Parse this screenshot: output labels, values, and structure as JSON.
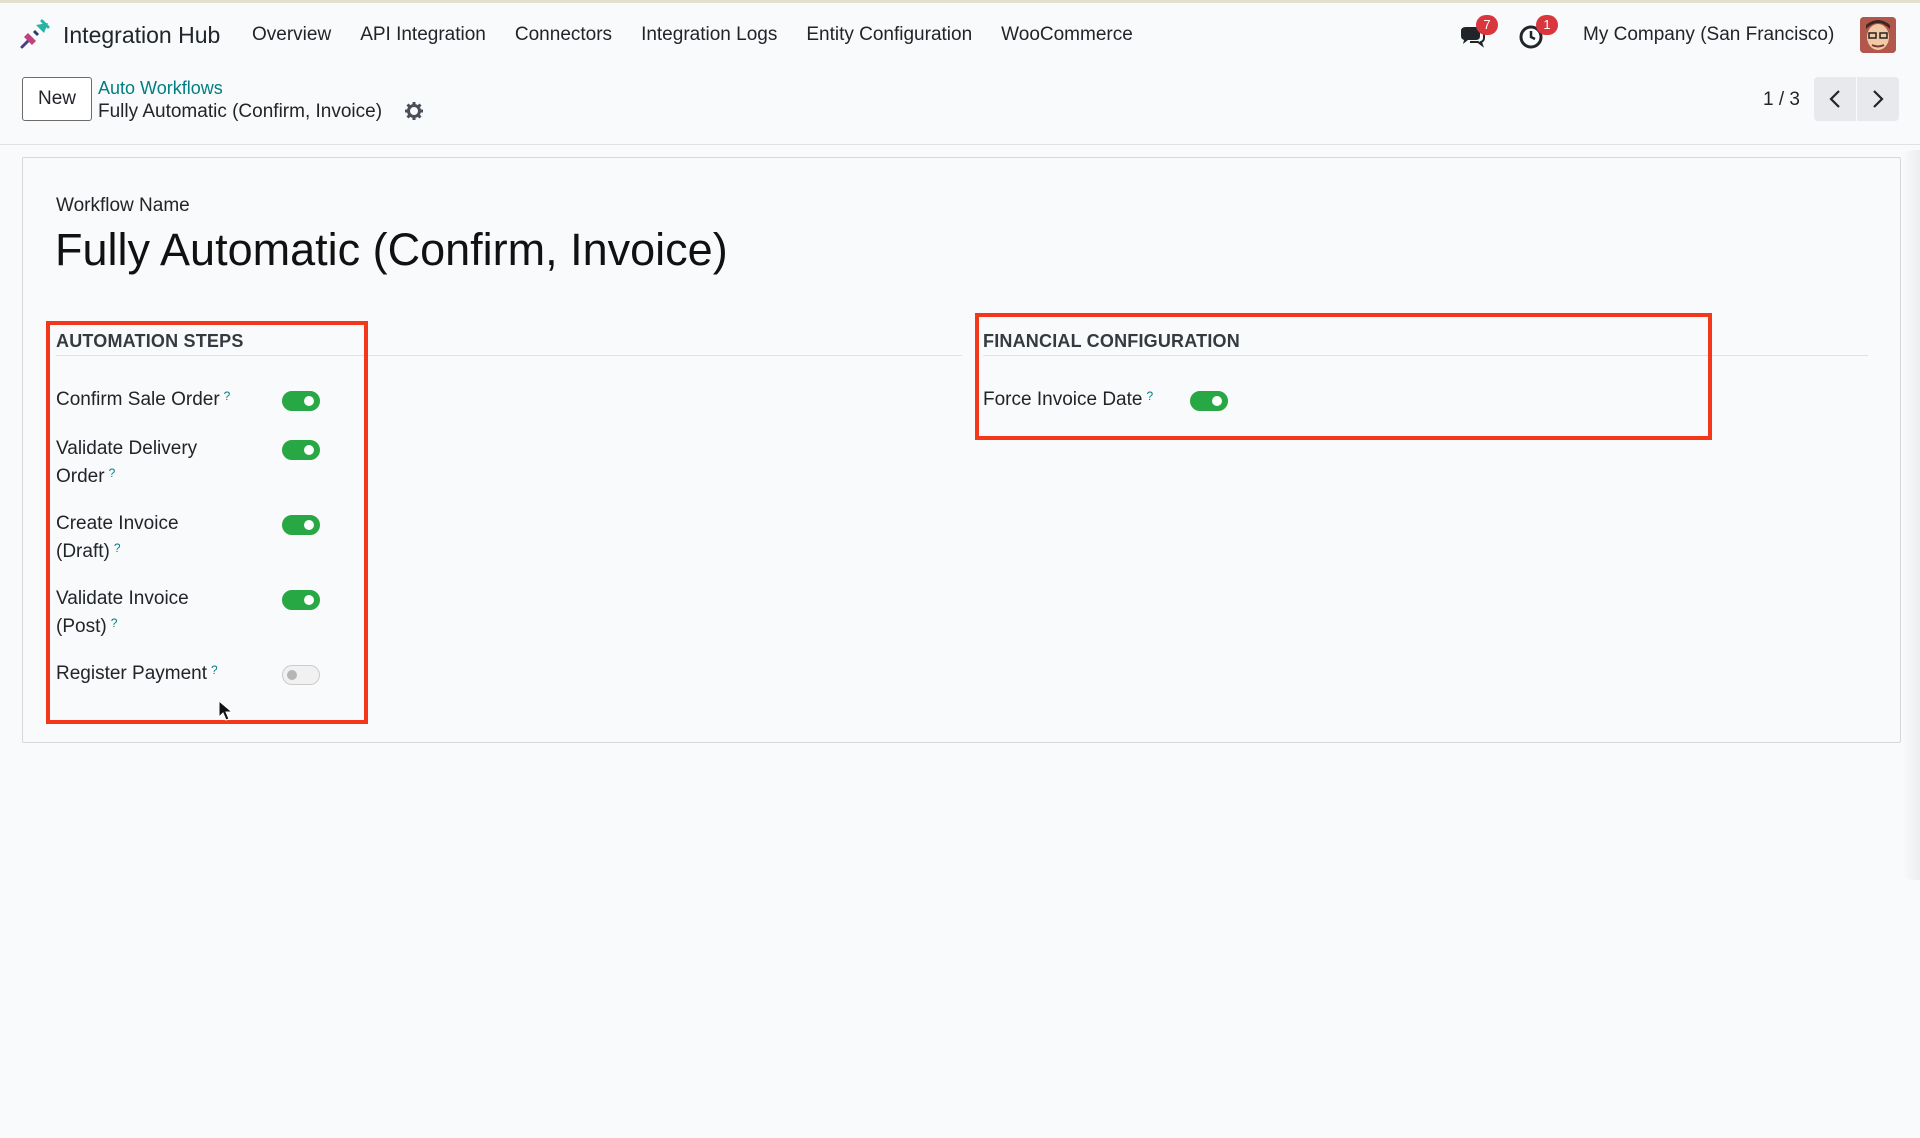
{
  "navbar": {
    "app_name": "Integration Hub",
    "menu": [
      "Overview",
      "API Integration",
      "Connectors",
      "Integration Logs",
      "Entity Configuration",
      "WooCommerce"
    ],
    "messages_count": "7",
    "activities_count": "1",
    "company": "My Company (San Francisco)"
  },
  "control_panel": {
    "new_label": "New",
    "breadcrumb_parent": "Auto Workflows",
    "breadcrumb_current": "Fully Automatic (Confirm, Invoice)",
    "pager_value": "1 / 3"
  },
  "form": {
    "name_label": "Workflow Name",
    "name_value": "Fully Automatic (Confirm, Invoice)",
    "automation_steps": {
      "title": "AUTOMATION STEPS",
      "fields": [
        {
          "label": "Confirm Sale Order",
          "help": "?",
          "enabled": true
        },
        {
          "label": "Validate Delivery Order",
          "help": "?",
          "enabled": true
        },
        {
          "label": "Create Invoice (Draft)",
          "help": "?",
          "enabled": true
        },
        {
          "label": "Validate Invoice (Post)",
          "help": "?",
          "enabled": true
        },
        {
          "label": "Register Payment",
          "help": "?",
          "enabled": false
        }
      ]
    },
    "financial_configuration": {
      "title": "FINANCIAL CONFIGURATION",
      "fields": [
        {
          "label": "Force Invoice Date",
          "help": "?",
          "enabled": true
        }
      ]
    }
  },
  "colors": {
    "accent": "#017e84",
    "toggle_on": "#28a745",
    "highlight": "#f2371b",
    "badge": "#d9363e"
  }
}
